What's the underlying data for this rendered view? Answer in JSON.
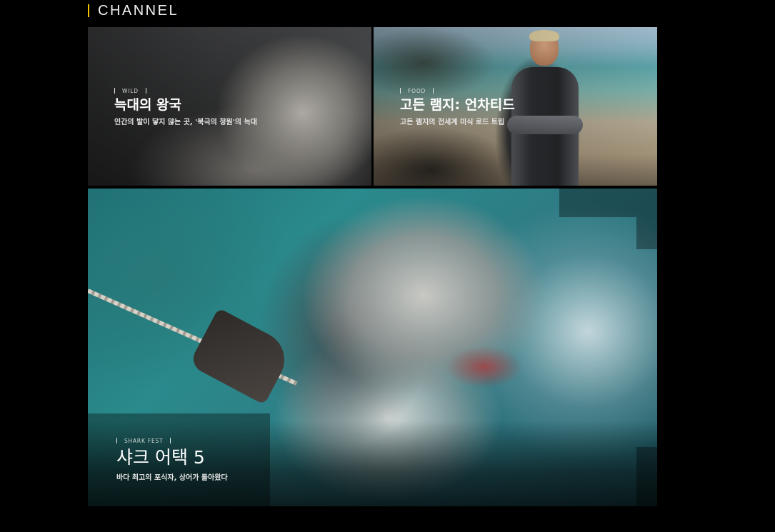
{
  "section": {
    "title": "CHANNEL",
    "accent_color": "#f2c500"
  },
  "cards": [
    {
      "id": "wild",
      "tag": "WILD",
      "title": "늑대의 왕국",
      "subtitle": "인간의 발이 닿지 않는 곳, '북극의 정원'의 늑대"
    },
    {
      "id": "food",
      "tag": "FOOD",
      "title": "고든 램지: 언차티드",
      "subtitle": "고든 램지의 전세계 미식 로드 트립"
    },
    {
      "id": "shark",
      "tag": "SHARK FEST",
      "title": "샤크 어택 5",
      "subtitle": "바다 최고의 포식자, 상어가 돌아왔다"
    }
  ]
}
